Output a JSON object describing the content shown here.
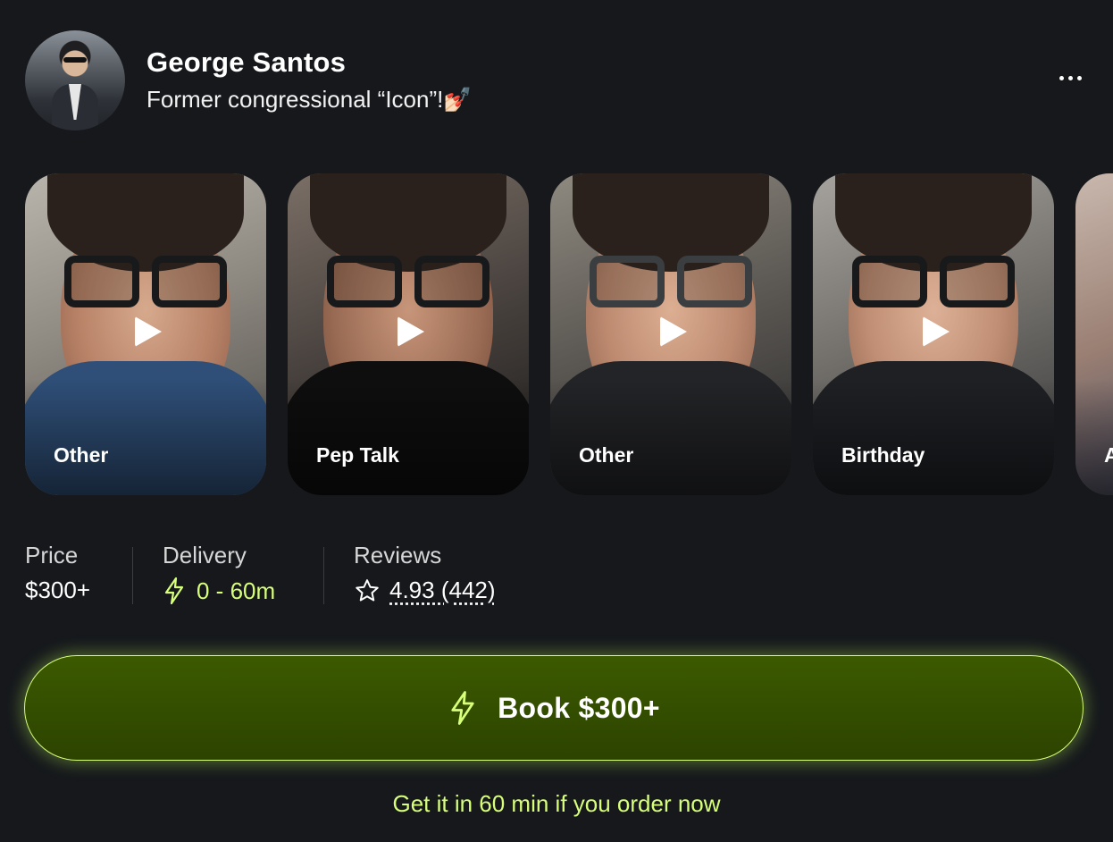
{
  "profile": {
    "name": "George Santos",
    "tagline": "Former congressional “Icon”!💅🏻"
  },
  "videos": [
    {
      "label": "Other"
    },
    {
      "label": "Pep Talk"
    },
    {
      "label": "Other"
    },
    {
      "label": "Birthday"
    },
    {
      "label": "A"
    }
  ],
  "stats": {
    "price_title": "Price",
    "price_value": "$300+",
    "delivery_title": "Delivery",
    "delivery_value": "0 - 60m",
    "reviews_title": "Reviews",
    "reviews_value": "4.93 (442)"
  },
  "book": {
    "label": "Book $300+",
    "note": "Get it in 60 min if you order now"
  },
  "colors": {
    "accent_green": "#d7ff7a",
    "button_bg": "#3c5a00",
    "page_bg": "#16181c"
  },
  "icons": [
    "more-icon",
    "play-icon",
    "bolt-icon",
    "star-icon"
  ]
}
